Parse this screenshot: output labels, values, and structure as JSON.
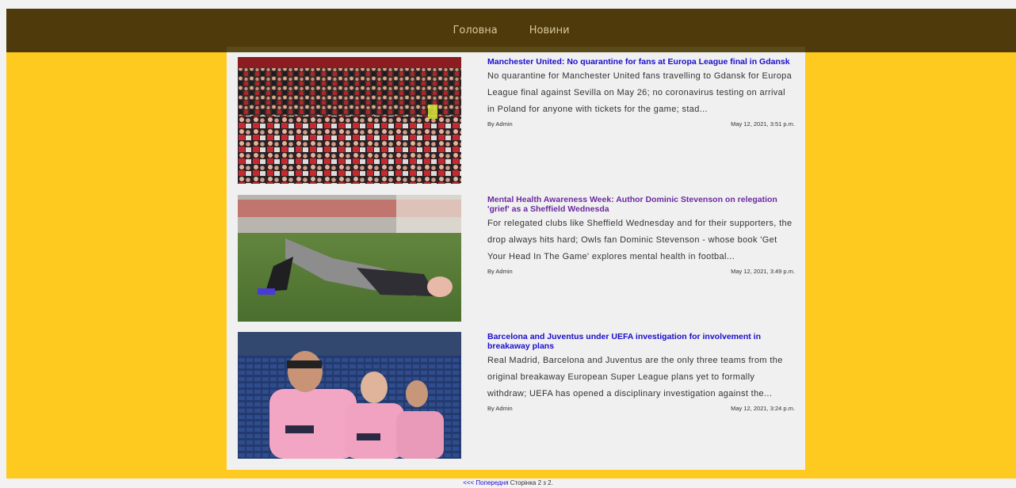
{
  "nav": {
    "items": [
      {
        "label": "Головна"
      },
      {
        "label": "Новини"
      }
    ]
  },
  "colors": {
    "nav_background": "#4e3a0a",
    "page_background": "#ffca1f",
    "content_background": "#f0f0f0",
    "link": "#1a0dcc",
    "link_visited": "#6b2aa0"
  },
  "articles": [
    {
      "title": "Manchester United: No quarantine for fans at Europa League final in Gdansk",
      "excerpt": "No quarantine for Manchester United fans travelling to Gdansk for Europa League final against Sevilla on May 26; no coronavirus testing on arrival in Poland for anyone with tickets for the game; stad...",
      "author": "By Admin",
      "date": "May 12, 2021, 3:51 p.m.",
      "image": "crowd-of-fans-photo"
    },
    {
      "title": "Mental Health Awareness Week: Author Dominic Stevenson on relegation 'grief' as a Sheffield Wednesda",
      "excerpt": "For relegated clubs like Sheffield Wednesday and for their supporters, the drop always hits hard; Owls fan Dominic Stevenson - whose book 'Get Your Head In The Game' explores mental health in footbal...",
      "author": "By Admin",
      "date": "May 12, 2021, 3:49 p.m.",
      "image": "player-lying-on-pitch-photo"
    },
    {
      "title": "Barcelona and Juventus under UEFA investigation for involvement in breakaway plans",
      "excerpt": "Real Madrid, Barcelona and Juventus are the only three teams from the original breakaway European Super League plans yet to formally withdraw; UEFA has opened a disciplinary investigation against the...",
      "author": "By Admin",
      "date": "May 12, 2021, 3:24 p.m.",
      "image": "barcelona-players-photo"
    }
  ],
  "pagination": {
    "prev_label": "<<< Попередня",
    "page_text": "Сторінка 2 з 2."
  }
}
